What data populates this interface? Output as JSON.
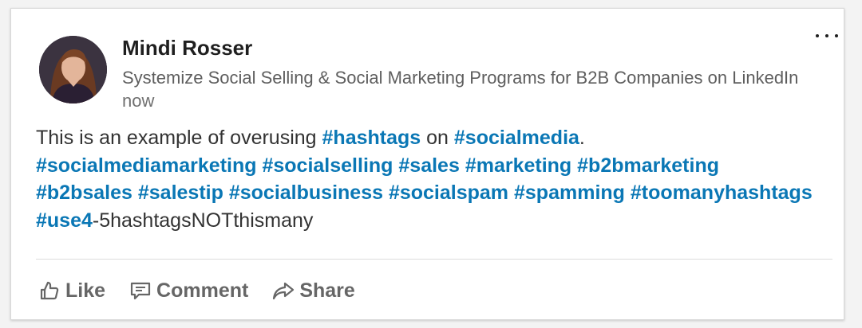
{
  "post": {
    "author": {
      "name": "Mindi Rosser",
      "headline": "Systemize Social Selling & Social Marketing Programs for B2B Companies on LinkedIn",
      "time": "now",
      "avatar_icon": "profile-photo"
    },
    "more_icon": "ellipsis-icon",
    "body": {
      "intro": "This is an example of overusing ",
      "tag_hashtags": "#hashtags",
      "text_on": " on ",
      "tag_socialmedia": "#socialmedia",
      "text_period": ".",
      "line2": [
        "#socialmediamarketing",
        "#socialselling",
        "#sales",
        "#marketing",
        "#b2bmarketing"
      ],
      "line3": [
        "#b2bsales",
        "#salestip",
        "#socialbusiness",
        "#socialspam",
        "#spamming",
        "#toomanyhashtags"
      ],
      "tag_use4": "#use4",
      "tail": "-5hashtagsNOTthismany"
    },
    "actions": {
      "like": {
        "label": "Like",
        "icon": "thumbs-up-icon"
      },
      "comment": {
        "label": "Comment",
        "icon": "comment-icon"
      },
      "share": {
        "label": "Share",
        "icon": "share-icon"
      }
    }
  },
  "colors": {
    "hashtag": "#0a77b5",
    "name": "#1f1f1f",
    "muted": "#666666"
  }
}
